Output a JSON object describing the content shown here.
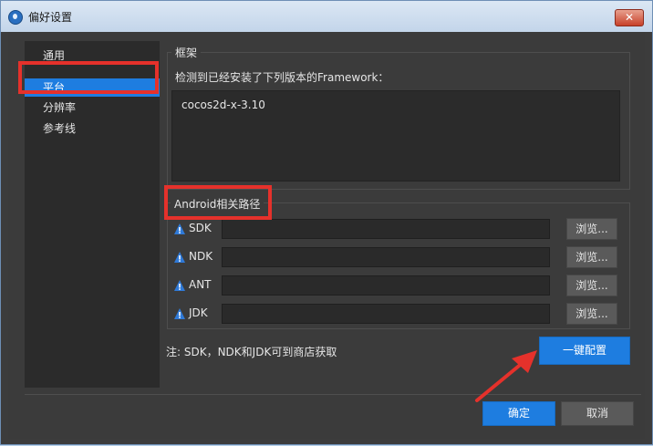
{
  "window": {
    "title": "偏好设置",
    "close_glyph": "✕"
  },
  "sidebar": {
    "items": [
      {
        "label": "通用"
      },
      {
        "label": "平台"
      },
      {
        "label": "分辨率"
      },
      {
        "label": "参考线"
      }
    ],
    "selected": 1
  },
  "framework": {
    "legend": "框架",
    "description": "检测到已经安装了下列版本的Framework：",
    "versions": [
      "cocos2d-x-3.10"
    ]
  },
  "android": {
    "legend": "Android相关路径",
    "paths": [
      {
        "label": "SDK",
        "value": "",
        "browse": "浏览..."
      },
      {
        "label": "NDK",
        "value": "",
        "browse": "浏览..."
      },
      {
        "label": "ANT",
        "value": "",
        "browse": "浏览..."
      },
      {
        "label": "JDK",
        "value": "",
        "browse": "浏览..."
      }
    ]
  },
  "note": "注: SDK，NDK和JDK可到商店获取",
  "buttons": {
    "auto_config": "一键配置",
    "ok": "确定",
    "cancel": "取消"
  },
  "colors": {
    "accent": "#1e7de0",
    "annotation": "#e5312b",
    "warning": "#2f7ad8"
  }
}
